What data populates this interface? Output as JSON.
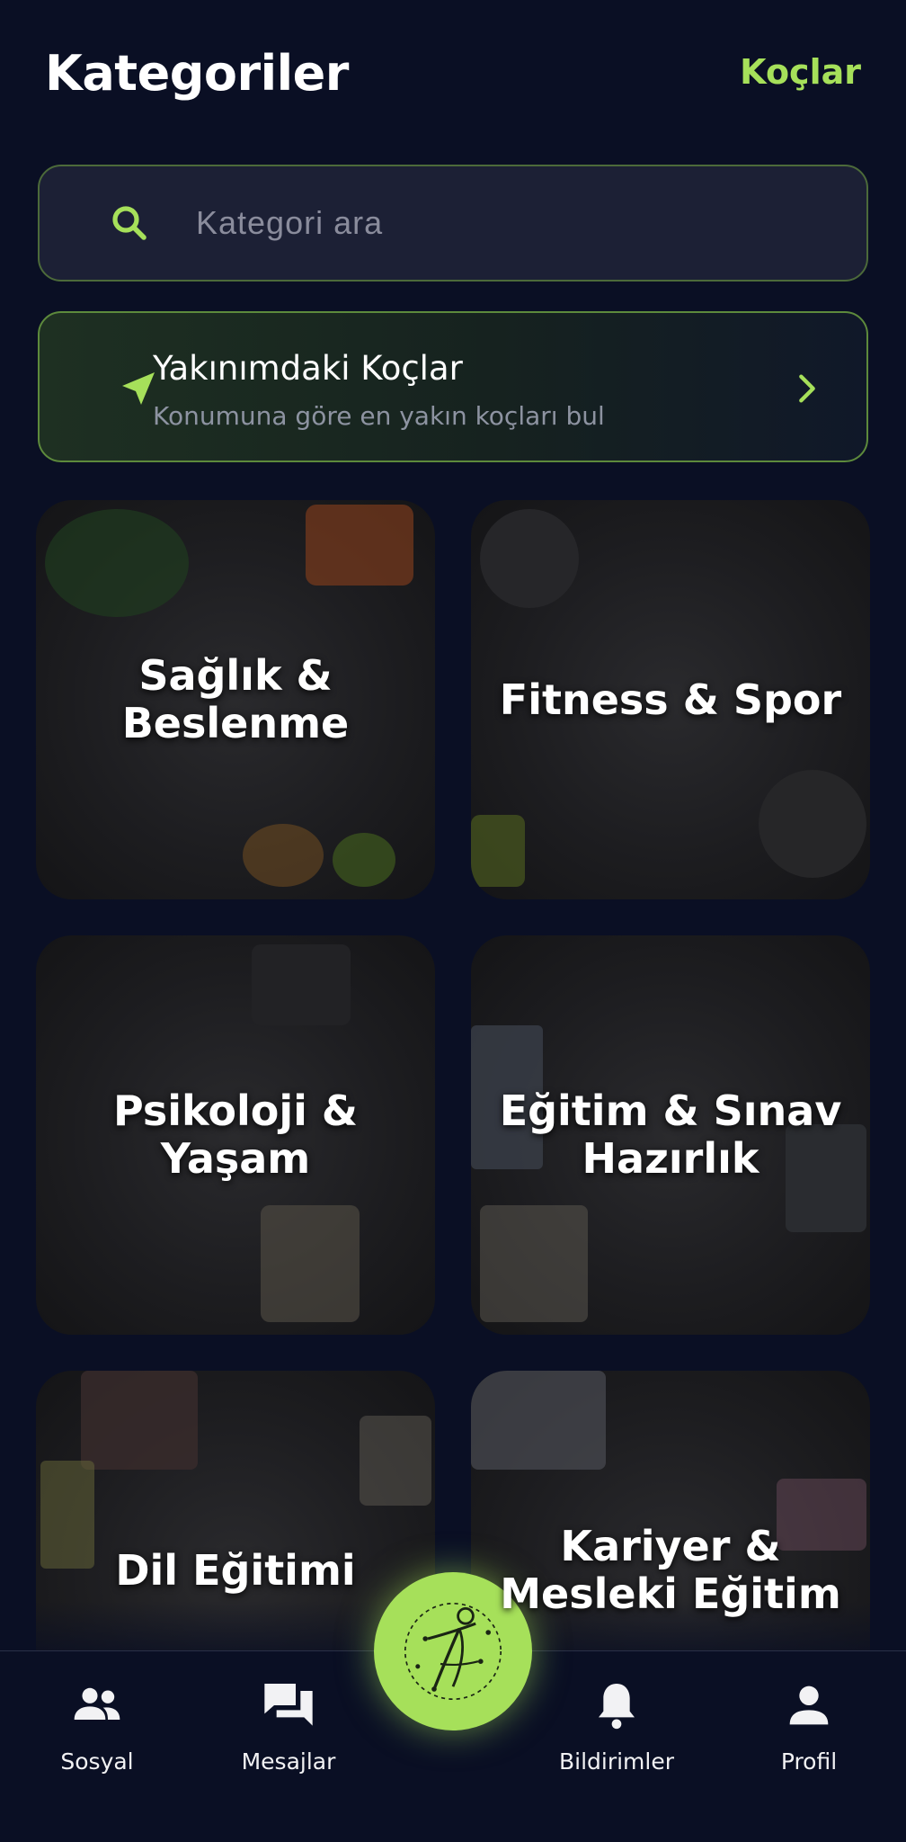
{
  "header": {
    "title": "Kategoriler",
    "coaches_link": "Koçlar"
  },
  "search": {
    "placeholder": "Kategori ara"
  },
  "nearby": {
    "title": "Yakınımdaki Koçlar",
    "subtitle": "Konumuna göre en yakın koçları bul"
  },
  "categories": [
    {
      "label": "Sağlık &\nBeslenme"
    },
    {
      "label": "Fitness & Spor"
    },
    {
      "label": "Psikoloji &\nYaşam"
    },
    {
      "label": "Eğitim & Sınav\nHazırlık"
    },
    {
      "label": "Dil Eğitimi"
    },
    {
      "label": "Kariyer &\nMesleki Eğitim"
    }
  ],
  "tabbar": {
    "items": [
      {
        "label": "Sosyal",
        "icon": "people-icon"
      },
      {
        "label": "Mesajlar",
        "icon": "chat-icon"
      },
      {
        "label": "Bildirimler",
        "icon": "bell-icon"
      },
      {
        "label": "Profil",
        "icon": "person-icon"
      }
    ],
    "center_icon": "app-logo-icon"
  },
  "colors": {
    "background": "#0a0f24",
    "accent": "#a6e05a",
    "card_border": "#5d8a3c"
  }
}
